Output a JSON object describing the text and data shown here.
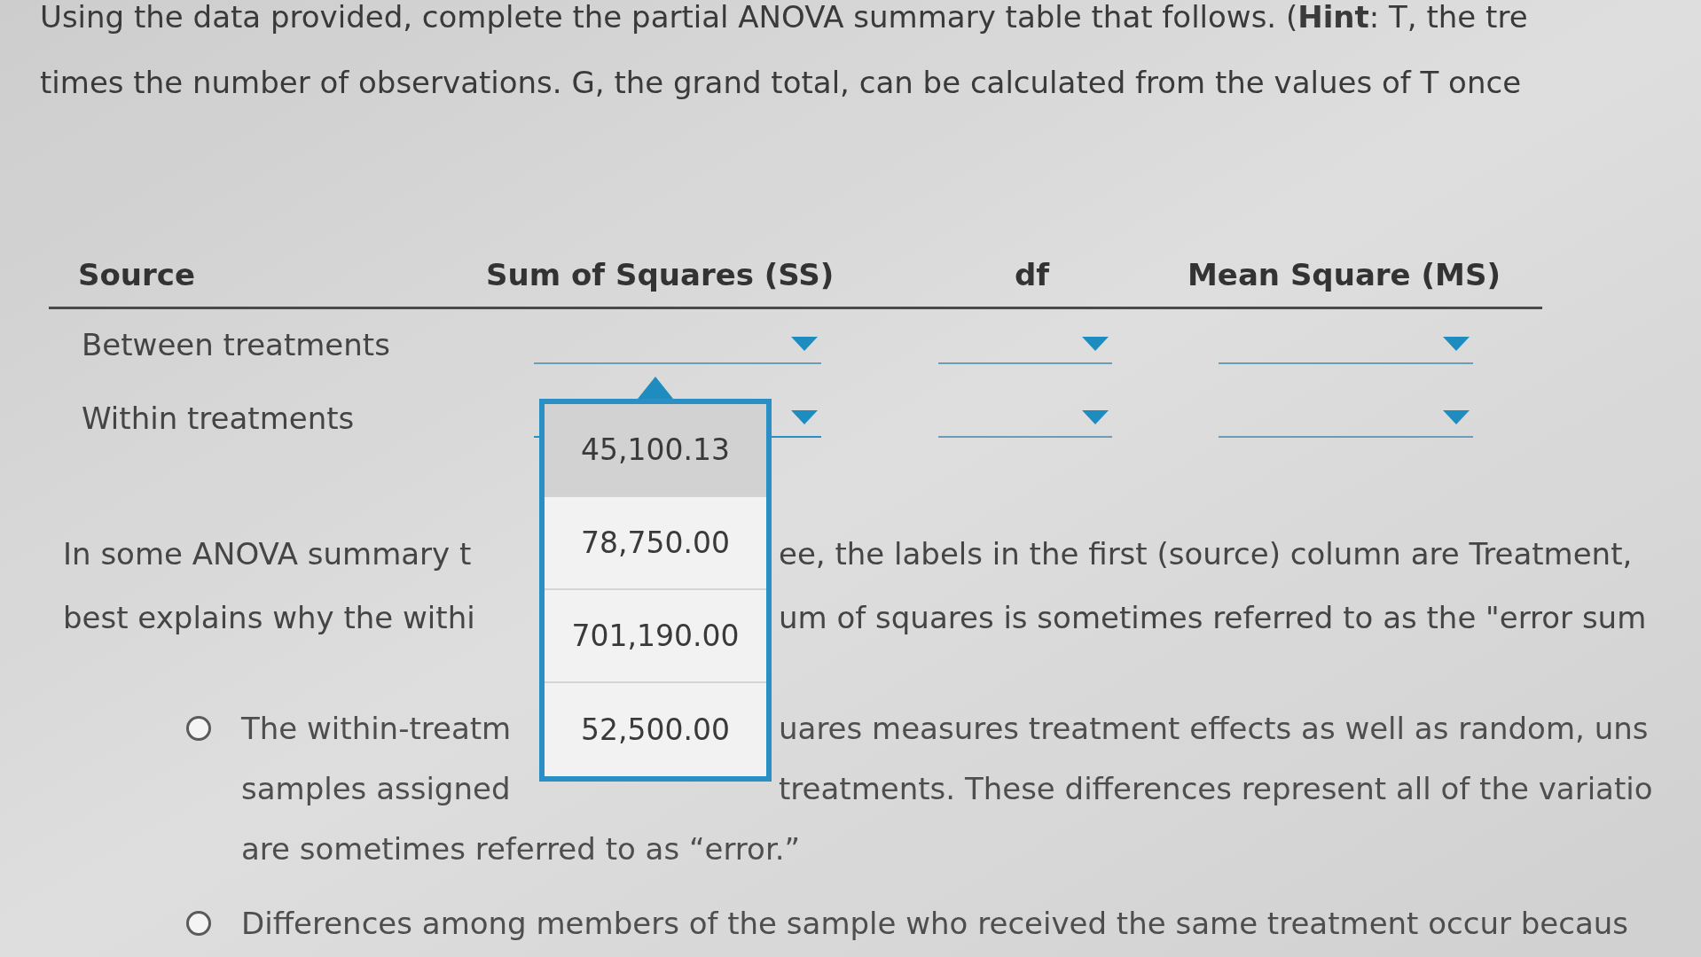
{
  "instructions": [
    "Using the data provided, complete the partial ANOVA summary table that follows. (**Hint**: T, the tre",
    "times the number of observations. G, the grand total, can be calculated from the values of T once"
  ],
  "table": {
    "columns": [
      "Source",
      "Sum of Squares (SS)",
      "df",
      "Mean Square (MS)"
    ],
    "rows": [
      {
        "source": "Between treatments",
        "dropdowns": [
          {
            "expanded": false
          },
          {
            "expanded": false
          },
          {
            "expanded": false
          }
        ]
      },
      {
        "source": "Within treatments",
        "dropdowns": [
          {
            "expanded": true,
            "options": [
              {
                "label": "45,100.13",
                "selected": true
              },
              {
                "label": "78,750.00",
                "selected": false
              },
              {
                "label": "701,190.00",
                "selected": false
              },
              {
                "label": "52,500.00",
                "selected": false
              }
            ]
          },
          {
            "expanded": false
          },
          {
            "expanded": false
          }
        ]
      }
    ]
  },
  "question": {
    "lines": [
      {
        "left": "In some ANOVA summary t",
        "right": "ee, the labels in the first (source) column are Treatment,"
      },
      {
        "left": "best explains why the withi",
        "right": "um of squares is sometimes referred to as the \"error sum"
      }
    ]
  },
  "choices": [
    {
      "selected": false,
      "lines": [
        {
          "left": "The within-treatm",
          "right": "uares measures treatment effects as well as random, uns"
        },
        {
          "left": "samples assigned",
          "right": "treatments. These differences represent all of the variatio"
        },
        {
          "left": "are sometimes referred to as “error.”"
        }
      ]
    },
    {
      "selected": false,
      "lines": [
        {
          "left": "Differences among members of the sample who received the same treatment occur becaus"
        }
      ]
    }
  ]
}
